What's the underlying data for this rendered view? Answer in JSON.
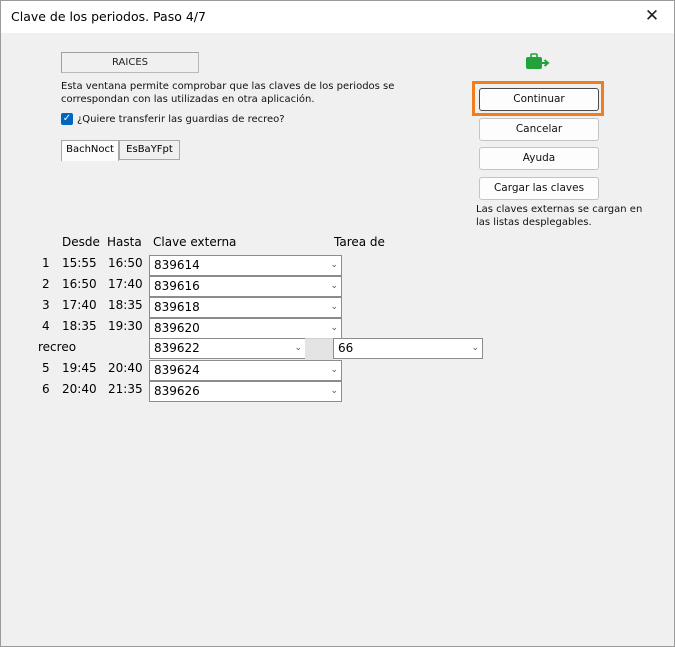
{
  "window": {
    "title": "Clave de los periodos. Paso 4/7",
    "close_label": "✕"
  },
  "raices_label": "RAICES",
  "description": "Esta ventana permite comprobar que las claves de los periodos se correspondan con las utilizadas en otra aplicación.",
  "checkbox": {
    "checked": true,
    "label": "¿Quiere transferir las guardias de recreo?"
  },
  "tabs": [
    "BachNoct",
    "EsBaYFpt"
  ],
  "buttons": {
    "continuar": "Continuar",
    "cancelar": "Cancelar",
    "ayuda": "Ayuda",
    "cargar": "Cargar las claves"
  },
  "note": "Las claves externas se cargan en las listas desplegables.",
  "headers": {
    "desde": "Desde",
    "hasta": "Hasta",
    "clave": "Clave externa",
    "tarea": "Tarea de"
  },
  "periods": [
    {
      "num": "1",
      "desde": "15:55",
      "hasta": "16:50",
      "clave": "839614"
    },
    {
      "num": "2",
      "desde": "16:50",
      "hasta": "17:40",
      "clave": "839616"
    },
    {
      "num": "3",
      "desde": "17:40",
      "hasta": "18:35",
      "clave": "839618"
    },
    {
      "num": "4",
      "desde": "18:35",
      "hasta": "19:30",
      "clave": "839620"
    },
    {
      "label": "recreo",
      "clave": "839622",
      "tarea": "66"
    },
    {
      "num": "5",
      "desde": "19:45",
      "hasta": "20:40",
      "clave": "839624"
    },
    {
      "num": "6",
      "desde": "20:40",
      "hasta": "21:35",
      "clave": "839626"
    }
  ],
  "icons": {
    "dropdown": "chevron-down-icon",
    "check": "checkmark-icon",
    "logo": "green-briefcase-arrow-icon"
  },
  "colors": {
    "focus_frame": "#f07d1f",
    "checkbox": "#0067c0",
    "logo": "#22a23a"
  }
}
